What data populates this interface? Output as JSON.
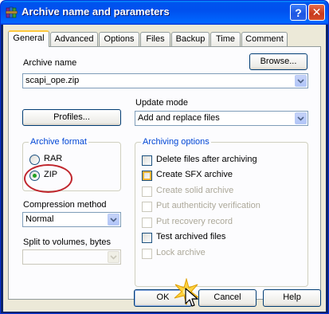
{
  "window": {
    "title": "Archive name and parameters",
    "help_glyph": "?",
    "close_glyph": "✕",
    "icon": "winrar-books-icon"
  },
  "tabs": [
    {
      "label": "General",
      "active": true
    },
    {
      "label": "Advanced"
    },
    {
      "label": "Options"
    },
    {
      "label": "Files"
    },
    {
      "label": "Backup"
    },
    {
      "label": "Time"
    },
    {
      "label": "Comment"
    }
  ],
  "general": {
    "archive_name_label": "Archive name",
    "browse_label": "Browse...",
    "archive_name_value": "scapi_ope.zip",
    "update_mode_label": "Update mode",
    "profiles_label": "Profiles...",
    "update_mode_value": "Add and replace files",
    "archive_format": {
      "label": "Archive format",
      "rar_label": "RAR",
      "zip_label": "ZIP",
      "selected": "ZIP"
    },
    "compression": {
      "label": "Compression method",
      "value": "Normal"
    },
    "split": {
      "label": "Split to volumes, bytes",
      "value": ""
    },
    "archiving_options": {
      "label": "Archiving options",
      "items": [
        {
          "label": "Delete files after archiving",
          "checked": false,
          "enabled": true
        },
        {
          "label": "Create SFX archive",
          "checked": false,
          "enabled": true
        },
        {
          "label": "Create solid archive",
          "checked": false,
          "enabled": false
        },
        {
          "label": "Put authenticity verification",
          "checked": false,
          "enabled": false
        },
        {
          "label": "Put recovery record",
          "checked": false,
          "enabled": false
        },
        {
          "label": "Test archived files",
          "checked": false,
          "enabled": true
        },
        {
          "label": "Lock archive",
          "checked": false,
          "enabled": false
        }
      ]
    }
  },
  "footer": {
    "ok_label": "OK",
    "cancel_label": "Cancel",
    "help_label": "Help"
  },
  "colors": {
    "title_bar": "#0053ee",
    "dialog_bg": "#ece9d8",
    "panel_bg": "#fcfcfe",
    "group_label": "#0046d5",
    "highlight_ellipse": "#c0262d",
    "radio_dot": "#21a121"
  }
}
